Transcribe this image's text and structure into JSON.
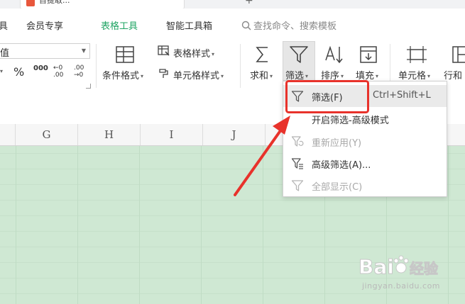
{
  "title_strip": {
    "doc_tab_text": "目提取...",
    "plus": "+"
  },
  "menu": {
    "tabs": [
      "具",
      "会员专享",
      "表格工具",
      "智能工具箱"
    ],
    "active_tab": "表格工具",
    "search_placeholder": "查找命令、搜索模板"
  },
  "ribbon": {
    "font_name_fragment": "值",
    "percent": "%",
    "thousands": "000",
    "inc_decimal": "←0 .00",
    "dec_decimal": ".00 →0",
    "conditional_format": "条件格式",
    "table_style": "表格样式",
    "cell_style": "单元格样式",
    "sum": "求和",
    "filter": "筛选",
    "sort": "排序",
    "fill": "填充",
    "cell": "单元格",
    "row_col": "行和"
  },
  "columns": [
    "G",
    "H",
    "I",
    "J"
  ],
  "dropdown": {
    "items": [
      {
        "label": "筛选(F)",
        "shortcut": "Ctrl+Shift+L",
        "disabled": false,
        "icon": "filter-icon"
      },
      {
        "label": "开启筛选-高级模式",
        "shortcut": "",
        "disabled": false,
        "icon": "none"
      },
      {
        "label": "重新应用(Y)",
        "shortcut": "",
        "disabled": true,
        "icon": "reapply-filter-icon"
      },
      {
        "label": "高级筛选(A)...",
        "shortcut": "",
        "disabled": false,
        "icon": "advanced-filter-icon"
      },
      {
        "label": "全部显示(C)",
        "shortcut": "",
        "disabled": true,
        "icon": "show-all-icon"
      }
    ]
  },
  "watermark": {
    "brand_text": "Bai",
    "brand_suffix": "经验",
    "url": "jingyan.baidu.com"
  },
  "colors": {
    "accent_green": "#1fa463",
    "grid_bg": "#cfe8d3",
    "annotation_red": "#e8322b"
  }
}
